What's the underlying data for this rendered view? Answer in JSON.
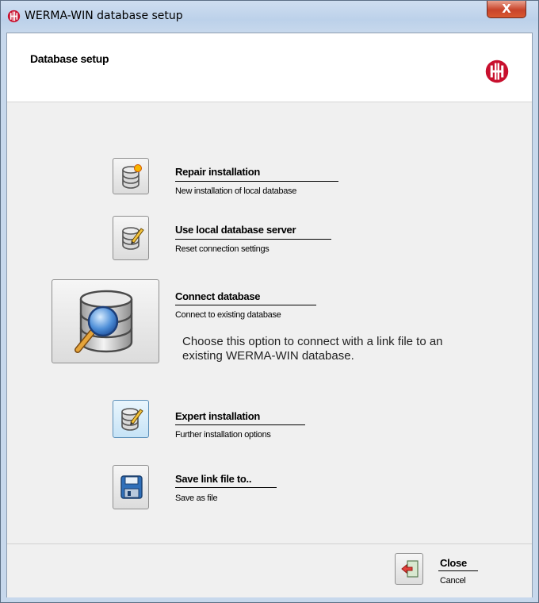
{
  "window": {
    "title": "WERMA-WIN database setup",
    "close_glyph": "X"
  },
  "header": {
    "title": "Database setup",
    "logo": "werma-logo"
  },
  "options": [
    {
      "title": "Repair installation",
      "subtitle": "New installation of local database",
      "icon": "database-star-icon"
    },
    {
      "title": "Use local database server",
      "subtitle": "Reset connection settings",
      "icon": "database-edit-icon"
    },
    {
      "title": "Connect database",
      "subtitle": "Connect to existing database",
      "icon": "database-search-icon",
      "description": "Choose this option to connect with a link file to an existing WERMA-WIN database."
    },
    {
      "title": "Expert installation",
      "subtitle": "Further installation options",
      "icon": "database-edit-icon"
    },
    {
      "title": "Save link file to..",
      "subtitle": "Save as file",
      "icon": "floppy-disk-icon"
    }
  ],
  "footer": {
    "close_title": "Close",
    "close_subtitle": "Cancel",
    "close_icon": "exit-door-icon"
  },
  "colors": {
    "accent_red": "#c8102e",
    "title_bar": "#c2d5ec",
    "client_bg": "#f0f0f0"
  }
}
